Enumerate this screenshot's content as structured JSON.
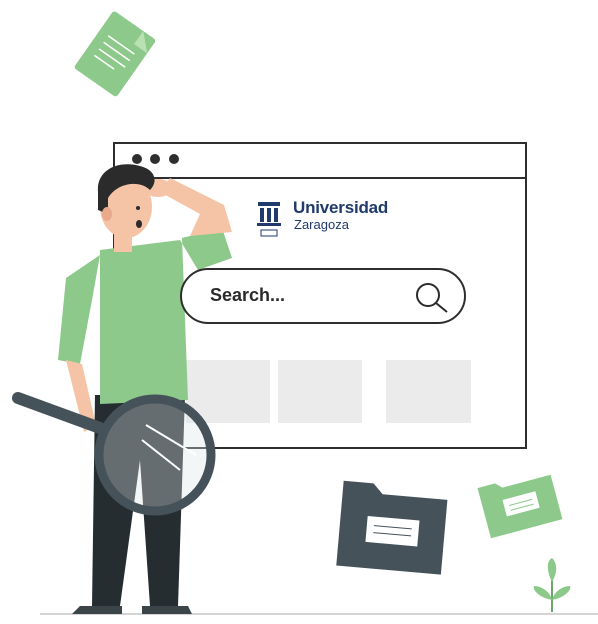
{
  "browser": {
    "logo": {
      "name": "Universidad",
      "subtitle": "Zaragoza"
    },
    "search": {
      "placeholder": "Search..."
    },
    "result_tiles": [
      "",
      "",
      ""
    ]
  },
  "colors": {
    "accent_green": "#8cc98a",
    "dark_slate": "#45525a",
    "brand_navy": "#1f3a6b",
    "tile_gray": "#ebebeb"
  },
  "icons": [
    "document-icon",
    "search-icon",
    "folder-icon",
    "plant-icon",
    "magnifying-glass-icon",
    "university-logo-icon"
  ]
}
